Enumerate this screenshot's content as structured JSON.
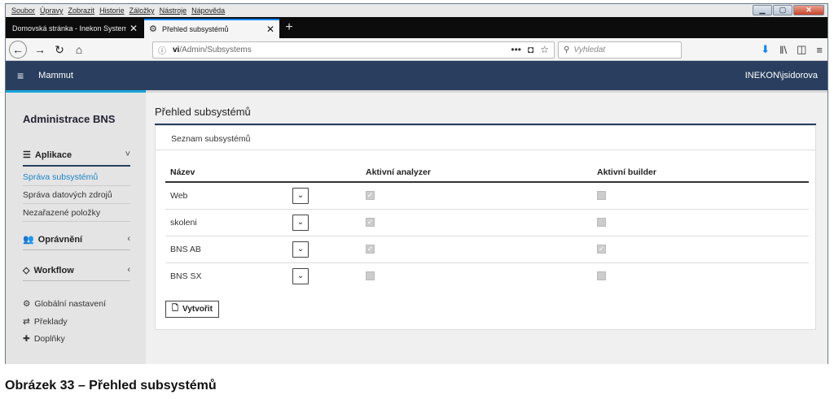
{
  "browser": {
    "menu": [
      "Soubor",
      "Úpravy",
      "Zobrazit",
      "Historie",
      "Záložky",
      "Nástroje",
      "Nápověda"
    ],
    "tabs": [
      {
        "title": "Domovská stránka - Inekon System",
        "close": "✕"
      },
      {
        "title": "Přehled subsystémů",
        "close": "✕"
      }
    ],
    "new_tab": "+",
    "url_host": "vi",
    "url_path": "/Admin/Subsystems",
    "search_placeholder": "Vyhledat",
    "url_more": "•••"
  },
  "app": {
    "brand": "Mammut",
    "user": "INEKON\\jsidorova",
    "colors": {
      "header": "#2a3f5f",
      "accent": "#1aa3d9",
      "active_link": "#1a85c8"
    }
  },
  "sidebar": {
    "title": "Administrace BNS",
    "sections": [
      {
        "label": "Aplikace",
        "icon": "list-icon",
        "chevron": "˅",
        "items": [
          "Správa subsystémů",
          "Správa datových zdrojů",
          "Nezařazené položky"
        ]
      },
      {
        "label": "Oprávnění",
        "icon": "users-icon",
        "chevron": "‹"
      },
      {
        "label": "Workflow",
        "icon": "workflow-icon",
        "chevron": "‹"
      }
    ],
    "links": [
      {
        "label": "Globální nastavení",
        "icon": "gear-icon"
      },
      {
        "label": "Překlady",
        "icon": "arrows-icon"
      },
      {
        "label": "Doplňky",
        "icon": "puzzle-icon"
      }
    ]
  },
  "main": {
    "page_title": "Přehled subsystémů",
    "panel_title": "Seznam subsystémů",
    "columns": [
      "Název",
      "Aktivní analyzer",
      "Aktivní builder"
    ],
    "rows": [
      {
        "name": "Web",
        "analyzer": true,
        "builder": false
      },
      {
        "name": "skoleni",
        "analyzer": true,
        "builder": false
      },
      {
        "name": "BNS AB",
        "analyzer": true,
        "builder": true
      },
      {
        "name": "BNS SX",
        "analyzer": false,
        "builder": false
      }
    ],
    "create_label": "Vytvořit"
  },
  "caption": "Obrázek 33 – Přehled subsystémů"
}
